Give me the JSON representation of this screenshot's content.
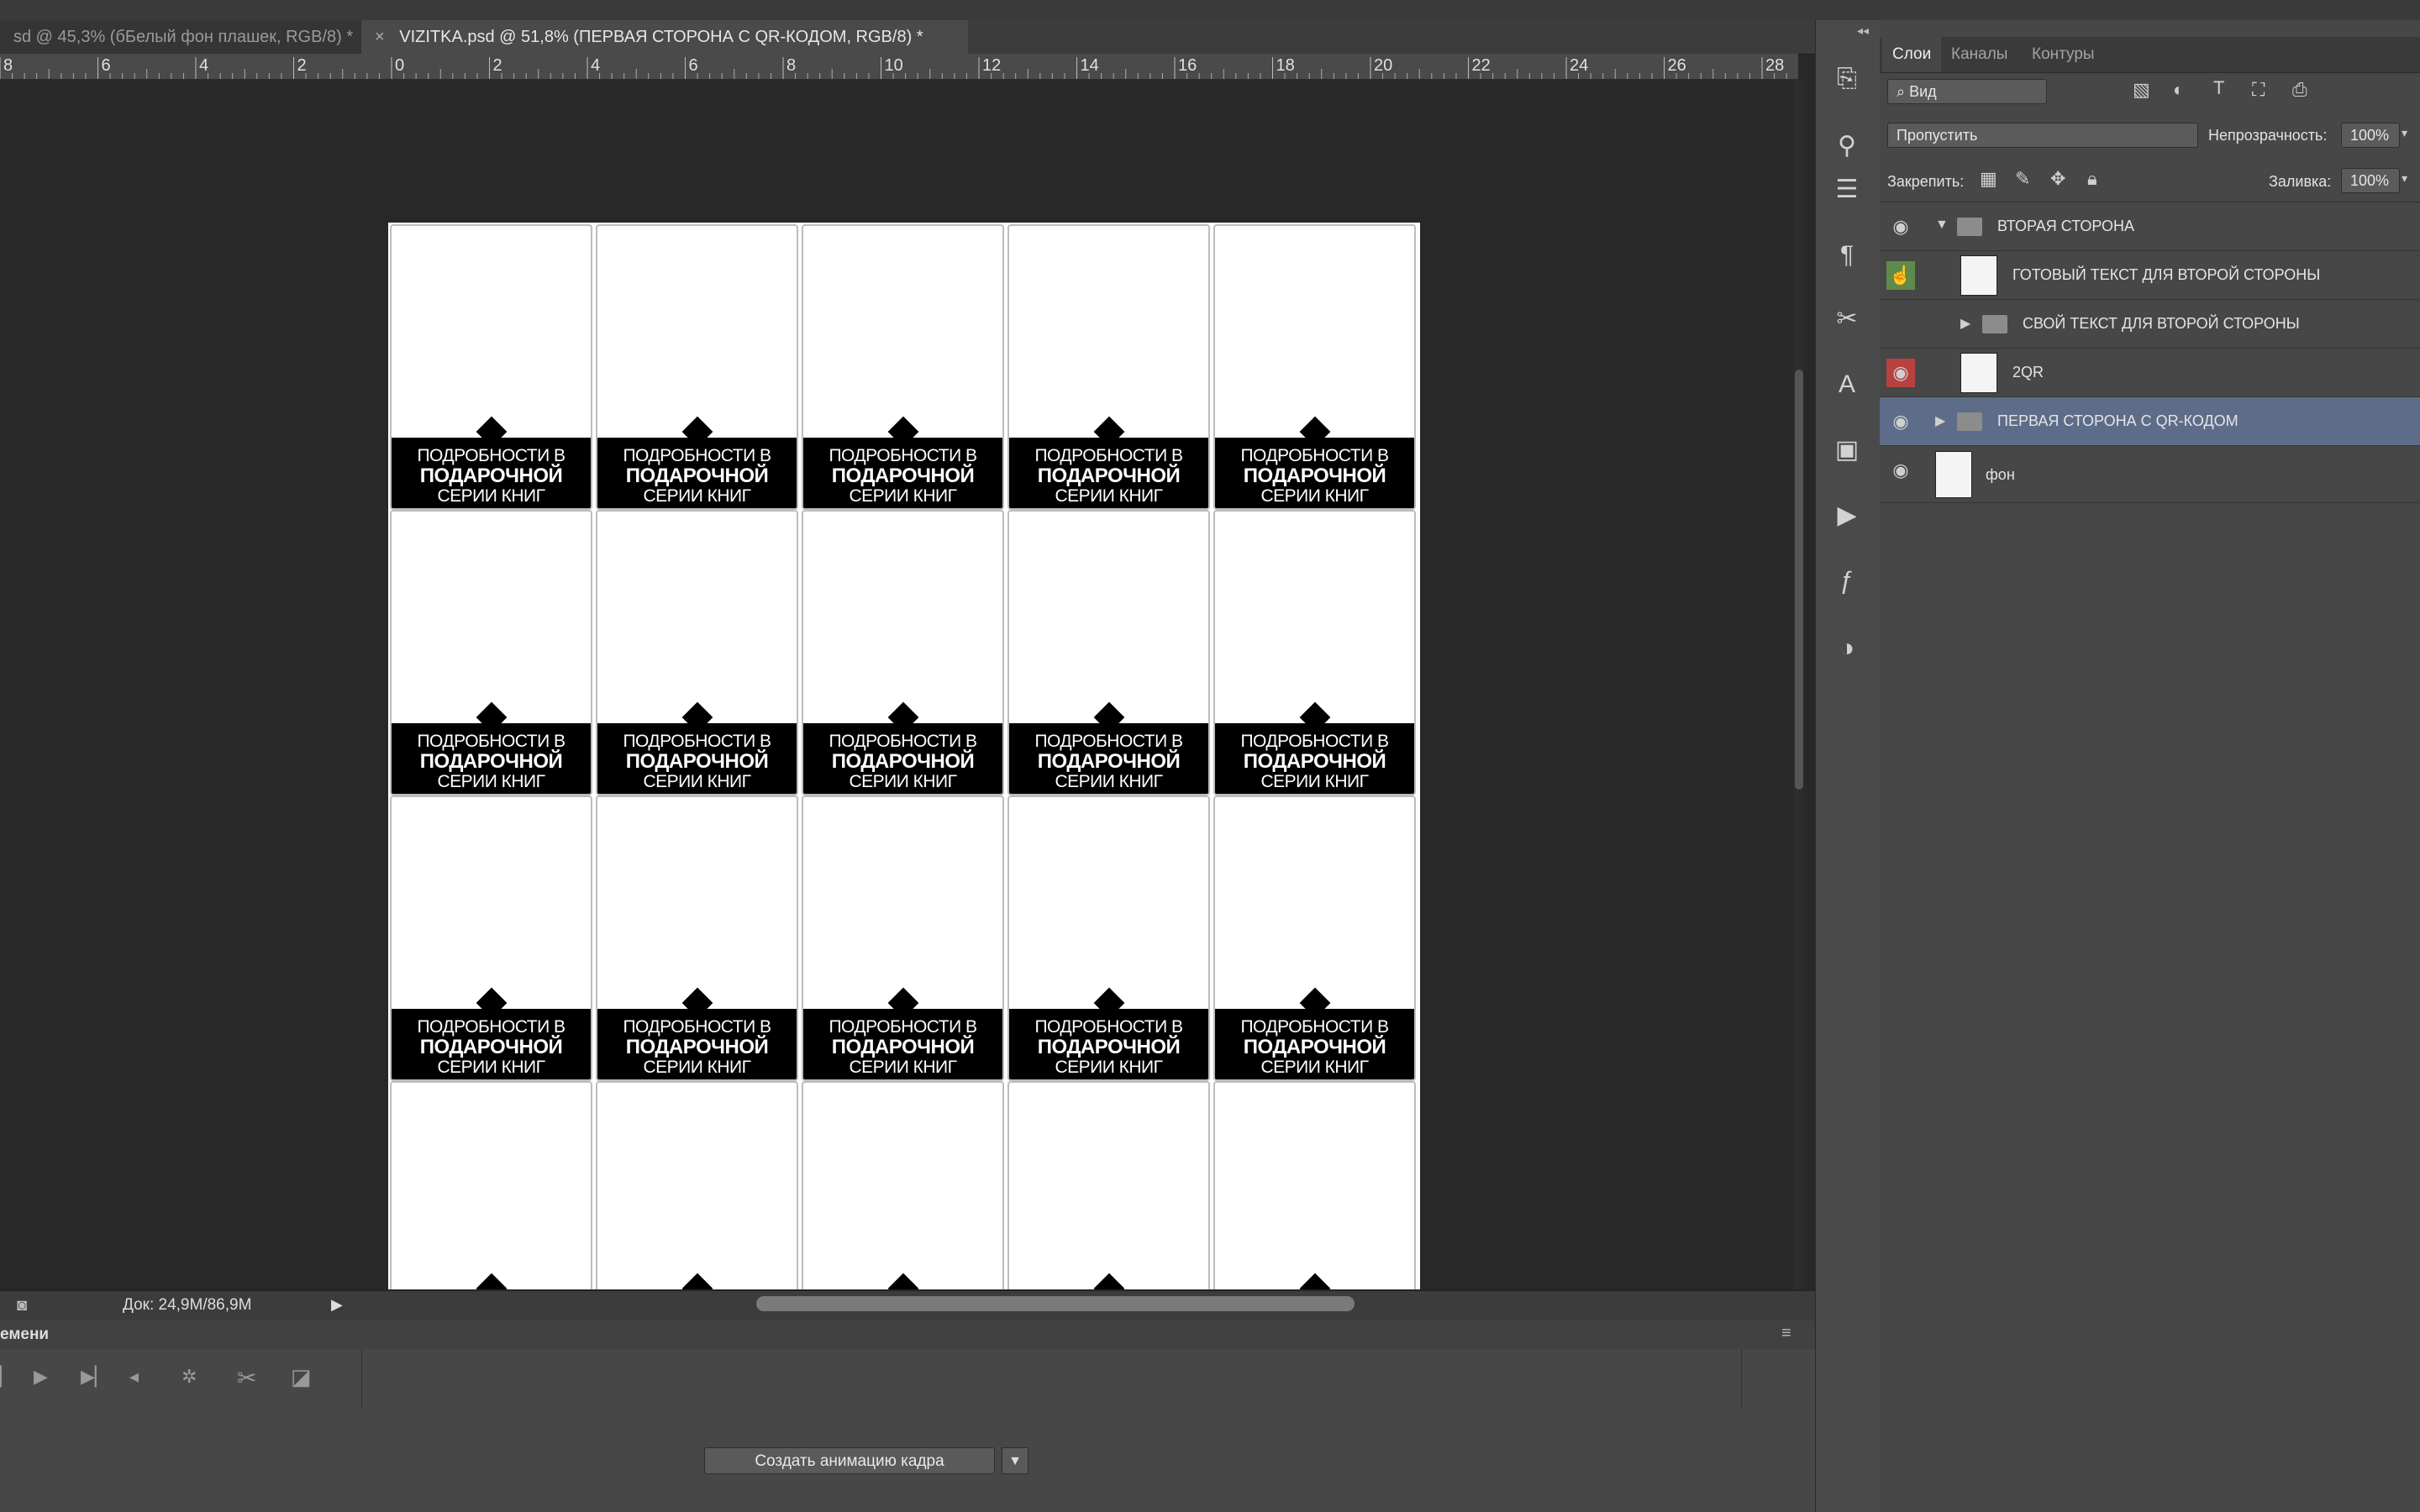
{
  "document_tabs": [
    {
      "label": "sd @ 45,3% (бБелый фон плашек, RGB/8) *",
      "active": false
    },
    {
      "label": "VIZITKA.psd @ 51,8% (ПЕРВАЯ СТОРОНА С QR-КОДОМ, RGB/8) *",
      "active": true
    }
  ],
  "ruler": {
    "labels": [
      "8",
      "6",
      "4",
      "2",
      "0",
      "2",
      "4",
      "6",
      "8",
      "10",
      "12",
      "14",
      "16",
      "18",
      "20",
      "22",
      "24",
      "26",
      "28"
    ]
  },
  "card": {
    "line1": "ПОДРОБНОСТИ В",
    "line2": "ПОДАРОЧНОЙ",
    "line3": "СЕРИИ КНИГ"
  },
  "status": {
    "doc_size": "Док: 24,9M/86,9M"
  },
  "timeline": {
    "title": "емени",
    "create_button": "Создать анимацию кадра"
  },
  "layers_panel": {
    "tabs": [
      "Слои",
      "Каналы",
      "Контуры"
    ],
    "filter_label": "Вид",
    "blend_mode": "Пропустить",
    "opacity_label": "Непрозрачность:",
    "opacity_value": "100%",
    "lock_label": "Закрепить:",
    "fill_label": "Заливка:",
    "fill_value": "100%",
    "layers": [
      {
        "name": "ВТОРАЯ СТОРОНА",
        "type": "group",
        "expanded": true
      },
      {
        "name": "ГОТОВЫЙ ТЕКСТ ДЛЯ ВТОРОЙ СТОРОНЫ",
        "type": "smart-object"
      },
      {
        "name": "СВОЙ ТЕКСТ ДЛЯ ВТОРОЙ СТОРОНЫ",
        "type": "group",
        "expanded": false
      },
      {
        "name": "2QR",
        "type": "smart-object"
      },
      {
        "name": "ПЕРВАЯ СТОРОНА С QR-КОДОМ",
        "type": "group",
        "expanded": false,
        "selected": true
      },
      {
        "name": "фон",
        "type": "layer"
      }
    ]
  },
  "colors": {
    "selected_row": "#5d6d89",
    "eye_green": "#5e8a4a",
    "eye_red": "#b8413f"
  }
}
